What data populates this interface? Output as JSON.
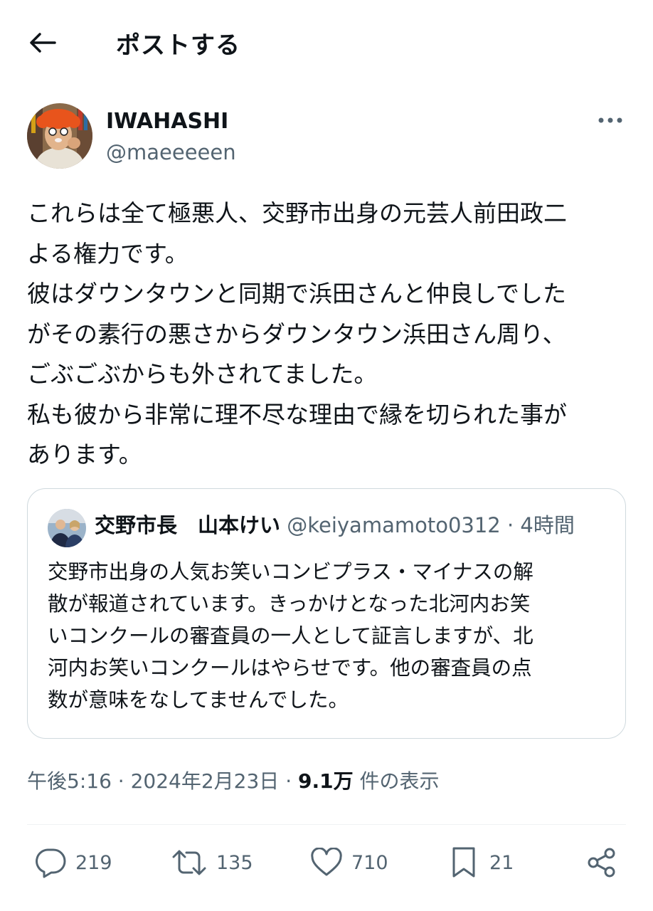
{
  "header": {
    "back_icon": "arrow-left-icon",
    "title": "ポストする"
  },
  "author": {
    "display_name": "IWAHASHI",
    "handle": "@maeeeeen",
    "more_icon": "more-horizontal-icon"
  },
  "post": {
    "lines": [
      "これらは全て極悪人、交野市出身の元芸人前田政二",
      "よる権力です。",
      "彼はダウンタウンと同期で浜田さんと仲良しでした",
      "がその素行の悪さからダウンタウン浜田さん周り、",
      "ごぶごぶからも外されてました。",
      "私も彼から非常に理不尽な理由で縁を切られた事が",
      "あります。"
    ]
  },
  "quote": {
    "name": "交野市長　山本けい",
    "handle": "@keiyamamoto0312",
    "separator": "·",
    "time": "4時間",
    "lines": [
      "交野市出身の人気お笑いコンビプラス・マイナスの解",
      "散が報道されています。きっかけとなった北河内お笑",
      "いコンクールの審査員の一人として証言しますが、北",
      "河内お笑いコンクールはやらせです。他の審査員の点",
      "数が意味をなしてませんでした。"
    ]
  },
  "meta": {
    "time": "午後5:16",
    "sep1": " · ",
    "date": "2024年2月23日",
    "sep2": " · ",
    "views": "9.1万",
    "views_label": " 件の表示"
  },
  "actions": {
    "reply": {
      "icon": "reply-icon",
      "count": "219"
    },
    "repost": {
      "icon": "repost-icon",
      "count": "135"
    },
    "like": {
      "icon": "heart-icon",
      "count": "710"
    },
    "bookmark": {
      "icon": "bookmark-icon",
      "count": "21"
    },
    "share": {
      "icon": "share-icon"
    }
  },
  "colors": {
    "text": "#0f1419",
    "secondary": "#536471",
    "border": "#cfd9de",
    "divider": "#eff3f4"
  }
}
